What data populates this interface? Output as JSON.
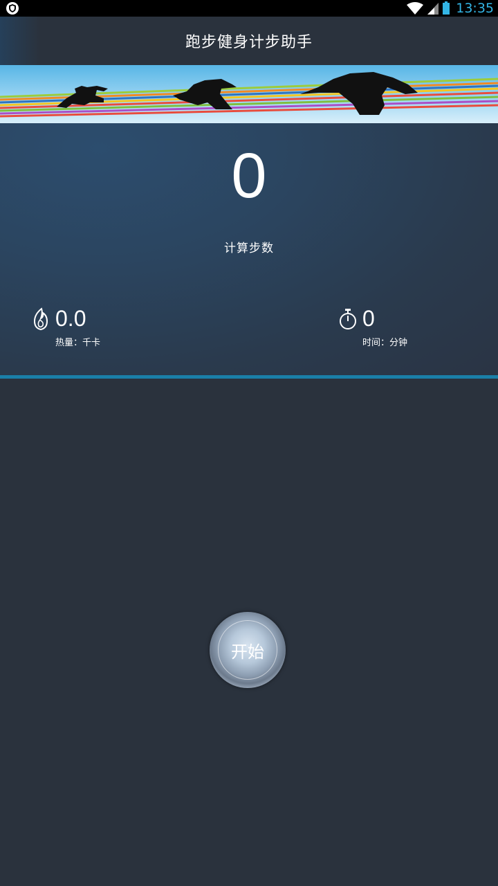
{
  "status_bar": {
    "time": "13:35",
    "icons": [
      "shield-icon",
      "wifi-icon",
      "signal-icon",
      "battery-icon"
    ]
  },
  "app_bar": {
    "title": "跑步健身计步助手"
  },
  "stats": {
    "steps_value": "0",
    "steps_label": "计算步数",
    "calories": {
      "icon": "flame-icon",
      "value": "0.0",
      "label": "热量：千卡"
    },
    "duration": {
      "icon": "stopwatch-icon",
      "value": "0",
      "label": "时间：分钟"
    }
  },
  "controls": {
    "start_label": "开始"
  },
  "colors": {
    "background": "#2a323d",
    "accent": "#1a7fa8",
    "clock": "#33b5e5"
  }
}
